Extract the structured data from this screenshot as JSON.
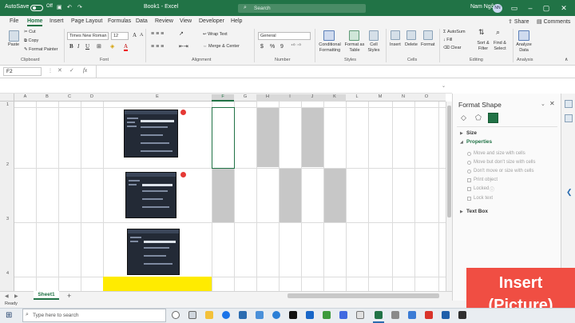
{
  "titlebar": {
    "autosave": "AutoSave",
    "toggle": "Off",
    "title": "Book1 - Excel",
    "search_placeholder": "Search",
    "user": "Nam Ngô",
    "initials": "NN"
  },
  "tabs": [
    "File",
    "Home",
    "Insert",
    "Page Layout",
    "Formulas",
    "Data",
    "Review",
    "View",
    "Developer",
    "Help"
  ],
  "ribbon_right": {
    "share": "Share",
    "comments": "Comments"
  },
  "clipboard": {
    "paste": "Paste",
    "cut": "Cut",
    "copy": "Copy",
    "format_painter": "Format Painter",
    "group": "Clipboard"
  },
  "font": {
    "name": "Times New Roman",
    "size": "12",
    "group": "Font",
    "bold": "B",
    "italic": "I",
    "underline": "U",
    "grow": "A",
    "shrink": "A",
    "color": "A"
  },
  "alignment": {
    "wrap": "Wrap Text",
    "merge": "Merge & Center",
    "group": "Alignment"
  },
  "number": {
    "format": "General",
    "currency": "$",
    "percent": "%",
    "comma": "9",
    "group": "Number"
  },
  "styles": {
    "conditional": "Conditional Formatting",
    "format_table": "Format as Table",
    "cell_styles": "Cell Styles",
    "group": "Styles"
  },
  "cells": {
    "insert": "Insert",
    "delete": "Delete",
    "format": "Format",
    "group": "Cells"
  },
  "editing": {
    "autosum": "AutoSum",
    "fill": "Fill",
    "clear": "Clear",
    "sort": "Sort & Filter",
    "find": "Find & Select",
    "group": "Editing"
  },
  "analysis": {
    "analyze": "Analyze Data",
    "group": "Analysis"
  },
  "formula_bar": {
    "name_box": "F2",
    "fx": "fx",
    "value": ""
  },
  "columns": [
    "A",
    "B",
    "C",
    "D",
    "E",
    "F",
    "G",
    "H",
    "I",
    "J",
    "K",
    "L",
    "M",
    "N",
    "O"
  ],
  "rows": [
    "1",
    "2",
    "3",
    "4"
  ],
  "sheet": {
    "tab": "Sheet1",
    "add": "+"
  },
  "status": {
    "text": "Ready"
  },
  "format_pane": {
    "title": "Format Shape",
    "size": "Size",
    "properties": "Properties",
    "opt1": "Move and size with cells",
    "opt2": "Move but don't size with cells",
    "opt3": "Don't move or size with cells",
    "print": "Print object",
    "locked": "Locked",
    "lock_text": "Lock text",
    "textbox": "Text Box"
  },
  "banner": {
    "line1": "Insert",
    "line2": "(Picture)"
  },
  "taskbar": {
    "search": "Type here to search"
  },
  "colors": {
    "excel_green": "#217346",
    "banner_red": "#f04e43",
    "highlight_yellow": "#ffeb00",
    "gray_fill": "#c7c7c7"
  }
}
